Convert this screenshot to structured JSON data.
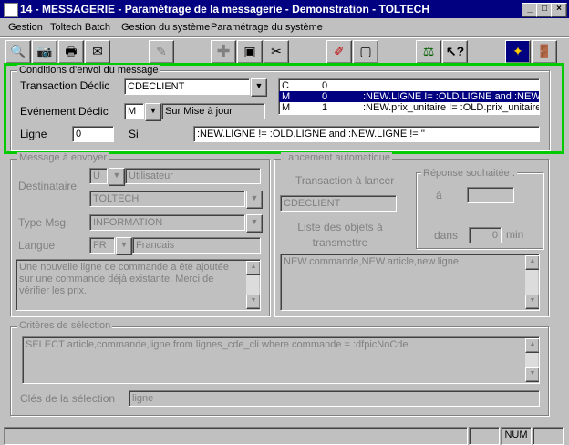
{
  "window": {
    "title": "14 - MESSAGERIE - Paramétrage de la messagerie - Demonstration - TOLTECH",
    "minimize": "_",
    "maximize": "□",
    "close": "×"
  },
  "menu": [
    "Gestion",
    "Toltech Batch",
    "Gestion du système",
    "Paramétrage du système"
  ],
  "toolbar": {
    "icons": [
      "magnifier-icon",
      "camera-icon",
      "printer-icon",
      "envelope-icon",
      "edit-disabled-icon",
      "plus-icon",
      "save-icon",
      "scissors-icon",
      "eraser-icon",
      "new-page-icon",
      "scale-icon",
      "help-icon",
      "app-icon",
      "exit-door-icon"
    ]
  },
  "conditions": {
    "legend": "Conditions d'envoi du message",
    "transaction_label": "Transaction Déclic",
    "transaction_value": "CDECLIENT",
    "evenement_label": "Evénement Déclic",
    "evenement_code": "M",
    "evenement_desc": "Sur Mise à jour",
    "ligne_label": "Ligne",
    "ligne_value": "0",
    "si_label": "Si",
    "si_value": ":NEW.LIGNE != :OLD.LIGNE and :NEW.LIGNE != ''",
    "list": [
      {
        "code": "C",
        "num": "0",
        "cond": ""
      },
      {
        "code": "M",
        "num": "0",
        "cond": ":NEW.LIGNE != :OLD.LIGNE and :NEW.L"
      },
      {
        "code": "M",
        "num": "1",
        "cond": ":NEW.prix_unitaire != :OLD.prix_unitaire"
      }
    ]
  },
  "message": {
    "legend": "Message à envoyer",
    "destinataire_label": "Destinataire",
    "dest_type": "U",
    "dest_type_desc": "Utilisateur",
    "dest_value": "TOLTECH",
    "type_label": "Type Msg.",
    "type_value": "INFORMATION",
    "langue_label": "Langue",
    "langue_code": "FR",
    "langue_desc": "Francais",
    "text": "Une nouvelle ligne de commande a été ajoutée sur une commande déjà existante. Merci de vérifier les prix."
  },
  "lancement": {
    "legend": "Lancement automatique",
    "transaction_label": "Transaction à lancer",
    "transaction_value": "CDECLIENT",
    "objets_label": "Liste des objets à transmettre",
    "objets_value": "NEW.commande,NEW.article,new.ligne",
    "reponse_legend": "Réponse souhaitée :",
    "a_label": "à",
    "a_value": "",
    "dans_label": "dans",
    "dans_value": "0",
    "min_label": "min"
  },
  "criteres": {
    "legend": "Critères de sélection",
    "sql": "SELECT article,commande,ligne from lignes_cde_cli where commande = :dfpicNoCde",
    "cles_label": "Clés de la sélection",
    "cles_value": "ligne"
  },
  "statusbar": {
    "num": "NUM"
  },
  "colors": {
    "title_bg": "#000080",
    "highlight": "#00cc00",
    "window_bg": "#c0c0c0"
  }
}
